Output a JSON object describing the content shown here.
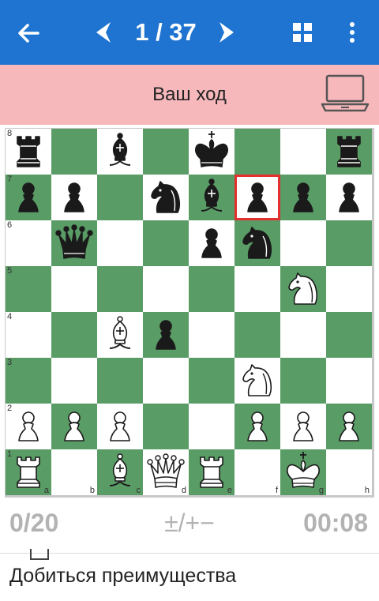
{
  "header": {
    "counter": "1 / 37",
    "back_icon": "arrow-left-icon",
    "prev_icon": "chevron-left-icon",
    "next_icon": "chevron-right-icon",
    "grid_icon": "grid-icon",
    "more_icon": "more-vertical-icon"
  },
  "status": {
    "text": "Ваш ход",
    "icon": "laptop-icon",
    "background": "#f7b8bb"
  },
  "board": {
    "light_color": "#ffffff",
    "dark_color": "#5a9c66",
    "highlight_color": "#e53030",
    "highlight_square": "f7",
    "ranks": [
      "8",
      "7",
      "6",
      "5",
      "4",
      "3",
      "2",
      "1"
    ],
    "files": [
      "a",
      "b",
      "c",
      "d",
      "e",
      "f",
      "g",
      "h"
    ],
    "position": [
      [
        "br",
        "",
        "bb",
        "",
        "bk",
        "",
        "",
        "br"
      ],
      [
        "bp",
        "bp",
        "",
        "bn",
        "bb",
        "bp",
        "bp",
        "bp"
      ],
      [
        "",
        "bq",
        "",
        "",
        "bp",
        "bn",
        "",
        ""
      ],
      [
        "",
        "",
        "",
        "",
        "",
        "",
        "wn",
        ""
      ],
      [
        "",
        "",
        "wb",
        "bp",
        "",
        "",
        "",
        ""
      ],
      [
        "",
        "",
        "",
        "",
        "",
        "wn",
        "",
        ""
      ],
      [
        "wp",
        "wp",
        "wp",
        "",
        "",
        "wp",
        "wp",
        "wp"
      ],
      [
        "wr",
        "",
        "wb",
        "wq",
        "wr",
        "",
        "wk",
        ""
      ]
    ]
  },
  "footer": {
    "score": "0/20",
    "evaluation": "±/+−",
    "timer": "00:08"
  },
  "task": {
    "label": "Добиться преимущества"
  }
}
